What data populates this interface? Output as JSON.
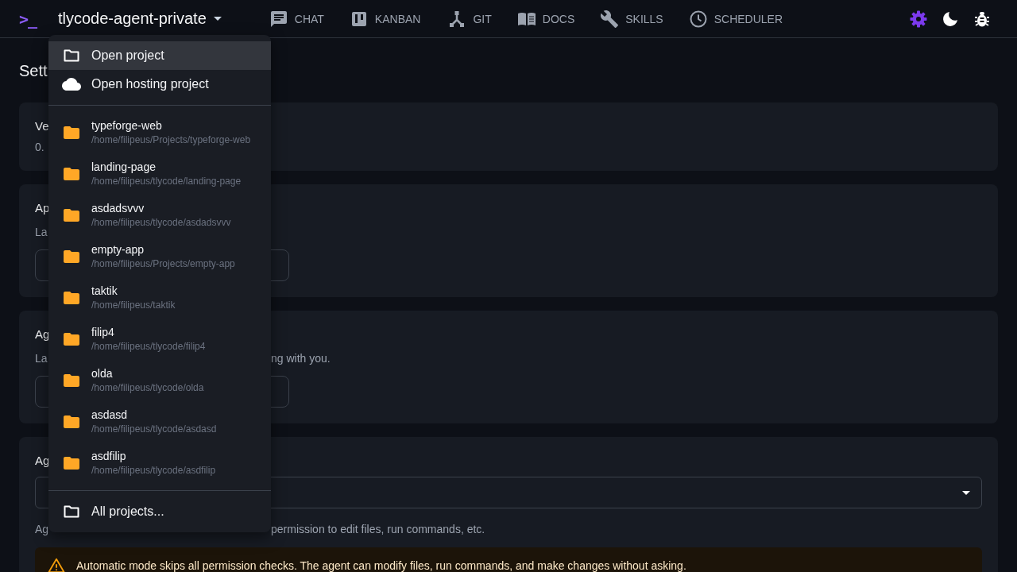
{
  "top_bar": {
    "logo": ">_",
    "project_title": "tlycode-agent-private",
    "nav": [
      {
        "kind": "chat",
        "label": "CHAT"
      },
      {
        "kind": "kanban",
        "label": "KANBAN"
      },
      {
        "kind": "git",
        "label": "GIT"
      },
      {
        "kind": "docs",
        "label": "DOCS"
      },
      {
        "kind": "skills",
        "label": "SKILLS"
      },
      {
        "kind": "scheduler",
        "label": "SCHEDULER"
      }
    ],
    "tools": [
      {
        "kind": "settings",
        "selected": true
      },
      {
        "kind": "theme",
        "selected": false
      },
      {
        "kind": "debug",
        "selected": false
      }
    ]
  },
  "page": {
    "title": "Sett",
    "cards": [
      {
        "lines": [
          {
            "kind": "heading",
            "lead": "Ve"
          },
          {
            "kind": "value",
            "lead": "0."
          }
        ]
      },
      {
        "lines": [
          {
            "kind": "heading",
            "lead": "Ap"
          },
          {
            "kind": "text",
            "lead": "La"
          },
          {
            "kind": "field"
          }
        ]
      },
      {
        "lines": [
          {
            "kind": "heading",
            "lead": "Ag"
          },
          {
            "kind": "text",
            "lead": "La",
            "tail": "ng with you."
          },
          {
            "kind": "field"
          }
        ]
      },
      {
        "lines": [
          {
            "kind": "heading",
            "lead": "Ag"
          },
          {
            "kind": "select"
          },
          {
            "kind": "text",
            "lead": "Ag",
            "tail": "permission to edit files, run commands, etc."
          },
          {
            "kind": "warning",
            "text": "Automatic mode skips all permission checks. The agent can modify files, run commands, and make changes without asking."
          }
        ]
      }
    ]
  },
  "project_menu": {
    "actions": [
      {
        "kind": "folder",
        "label": "Open project",
        "selected": true
      },
      {
        "kind": "cloud",
        "label": "Open hosting project",
        "selected": false
      }
    ],
    "projects": [
      {
        "name": "typeforge-web",
        "path": "/home/filipeus/Projects/typeforge-web",
        "selected": false
      },
      {
        "name": "landing-page",
        "path": "/home/filipeus/tlycode/landing-page",
        "selected": false
      },
      {
        "name": "asdadsvvv",
        "path": "/home/filipeus/tlycode/asdadsvvv",
        "selected": false
      },
      {
        "name": "empty-app",
        "path": "/home/filipeus/Projects/empty-app",
        "selected": false
      },
      {
        "name": "taktik",
        "path": "/home/filipeus/taktik",
        "selected": false
      },
      {
        "name": "filip4",
        "path": "/home/filipeus/tlycode/filip4",
        "selected": false
      },
      {
        "name": "olda",
        "path": "/home/filipeus/tlycode/olda",
        "selected": false
      },
      {
        "name": "asdasd",
        "path": "/home/filipeus/tlycode/asdasd",
        "selected": false
      },
      {
        "name": "asdfilip",
        "path": "/home/filipeus/tlycode/asdfilip",
        "selected": false
      }
    ],
    "footer": {
      "label": "All projects...",
      "selected": false
    }
  }
}
